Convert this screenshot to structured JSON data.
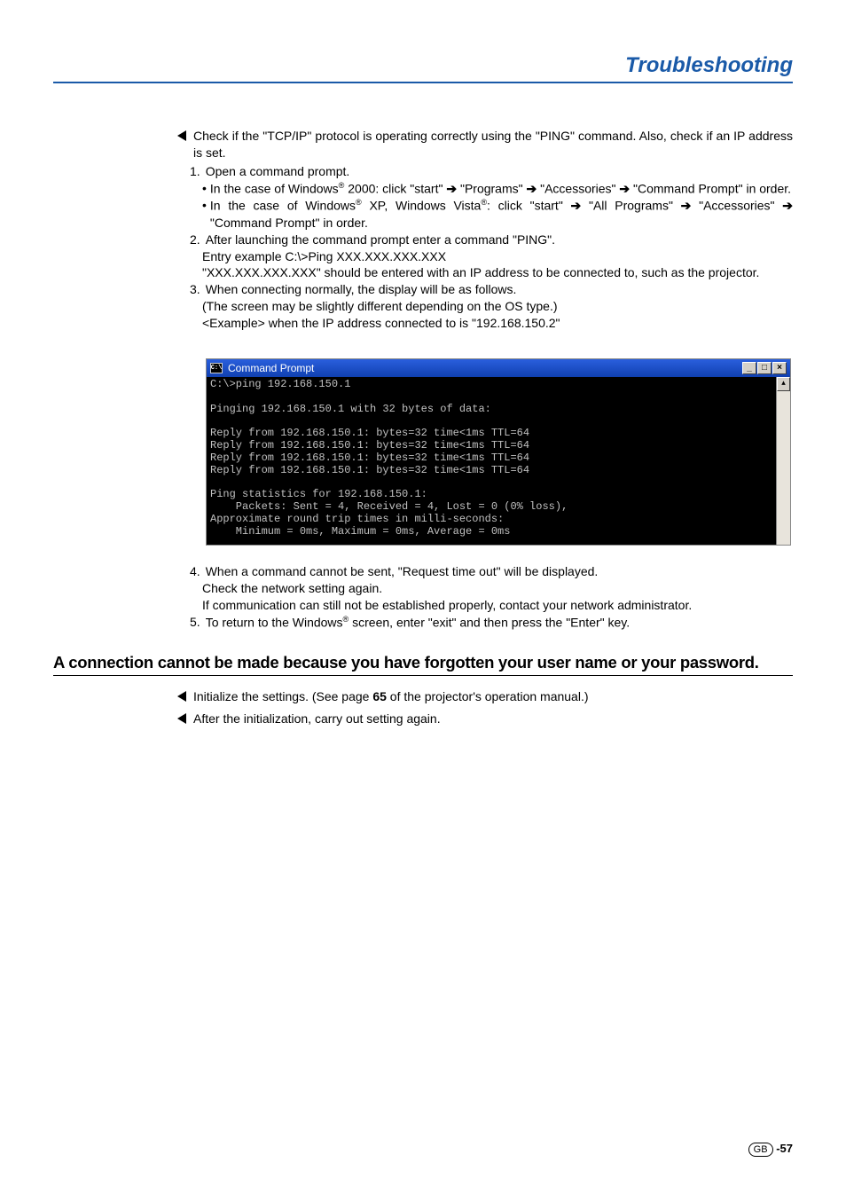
{
  "header": {
    "title": "Troubleshooting"
  },
  "intro": {
    "bullet": "Check if the \"TCP/IP\" protocol is operating correctly using the \"PING\" command. Also, check if an IP address is set."
  },
  "steps": {
    "s1": {
      "num": "1.",
      "text": "Open a command prompt."
    },
    "s1a_pre": "In the case of Windows",
    "s1a_post": " 2000: click \"start\" ",
    "s1a_p1": " \"Programs\" ",
    "s1a_p2": " \"Accessories\" ",
    "s1a_p3": " \"Command Prompt\" in order.",
    "s1b_pre": "In the case of Windows",
    "s1b_mid1": " XP, Windows Vista",
    "s1b_mid2": ": click \"start\" ",
    "s1b_p1": " \"All Programs\" ",
    "s1b_p2": " \"Accessories\" ",
    "s1b_p3": " \"Command Prompt\" in order.",
    "s2": {
      "num": "2.",
      "text": "After launching the command prompt enter a command \"PING\"."
    },
    "s2l2": "Entry example C:\\>Ping XXX.XXX.XXX.XXX",
    "s2l3": "\"XXX.XXX.XXX.XXX\" should be entered with an IP address to be connected to, such as the projector.",
    "s3": {
      "num": "3.",
      "text": "When connecting normally, the display will be as follows."
    },
    "s3l2": "(The screen may be slightly different depending on the OS type.)",
    "s3l3": "<Example> when the IP address connected to is \"192.168.150.2\"",
    "s4": {
      "num": "4.",
      "text": "When a command cannot be sent, \"Request time out\" will be displayed."
    },
    "s4l2": "Check the network setting again.",
    "s4l3": "If communication can still not be established properly, contact your network administrator.",
    "s5": {
      "num": "5.",
      "pre": "To return to the Windows",
      "post": " screen, enter \"exit\" and then press the \"Enter\" key."
    }
  },
  "cmd": {
    "icon_text": "C:\\",
    "title": "Command Prompt",
    "body": "C:\\>ping 192.168.150.1\n\nPinging 192.168.150.1 with 32 bytes of data:\n\nReply from 192.168.150.1: bytes=32 time<1ms TTL=64\nReply from 192.168.150.1: bytes=32 time<1ms TTL=64\nReply from 192.168.150.1: bytes=32 time<1ms TTL=64\nReply from 192.168.150.1: bytes=32 time<1ms TTL=64\n\nPing statistics for 192.168.150.1:\n    Packets: Sent = 4, Received = 4, Lost = 0 (0% loss),\nApproximate round trip times in milli-seconds:\n    Minimum = 0ms, Maximum = 0ms, Average = 0ms"
  },
  "section2": {
    "heading": "A connection cannot be made because you have forgotten your user name or your password.",
    "b1_pre": "Initialize the settings. (See page ",
    "b1_bold": "65",
    "b1_post": " of the projector's operation manual.)",
    "b2": "After the initialization, carry out setting again."
  },
  "footer": {
    "region": "GB",
    "sep": "-",
    "page": "57"
  },
  "glyphs": {
    "arrow": "➔",
    "reg": "®",
    "dot": "•",
    "min": "_",
    "max": "□",
    "close": "×",
    "up": "▴"
  }
}
